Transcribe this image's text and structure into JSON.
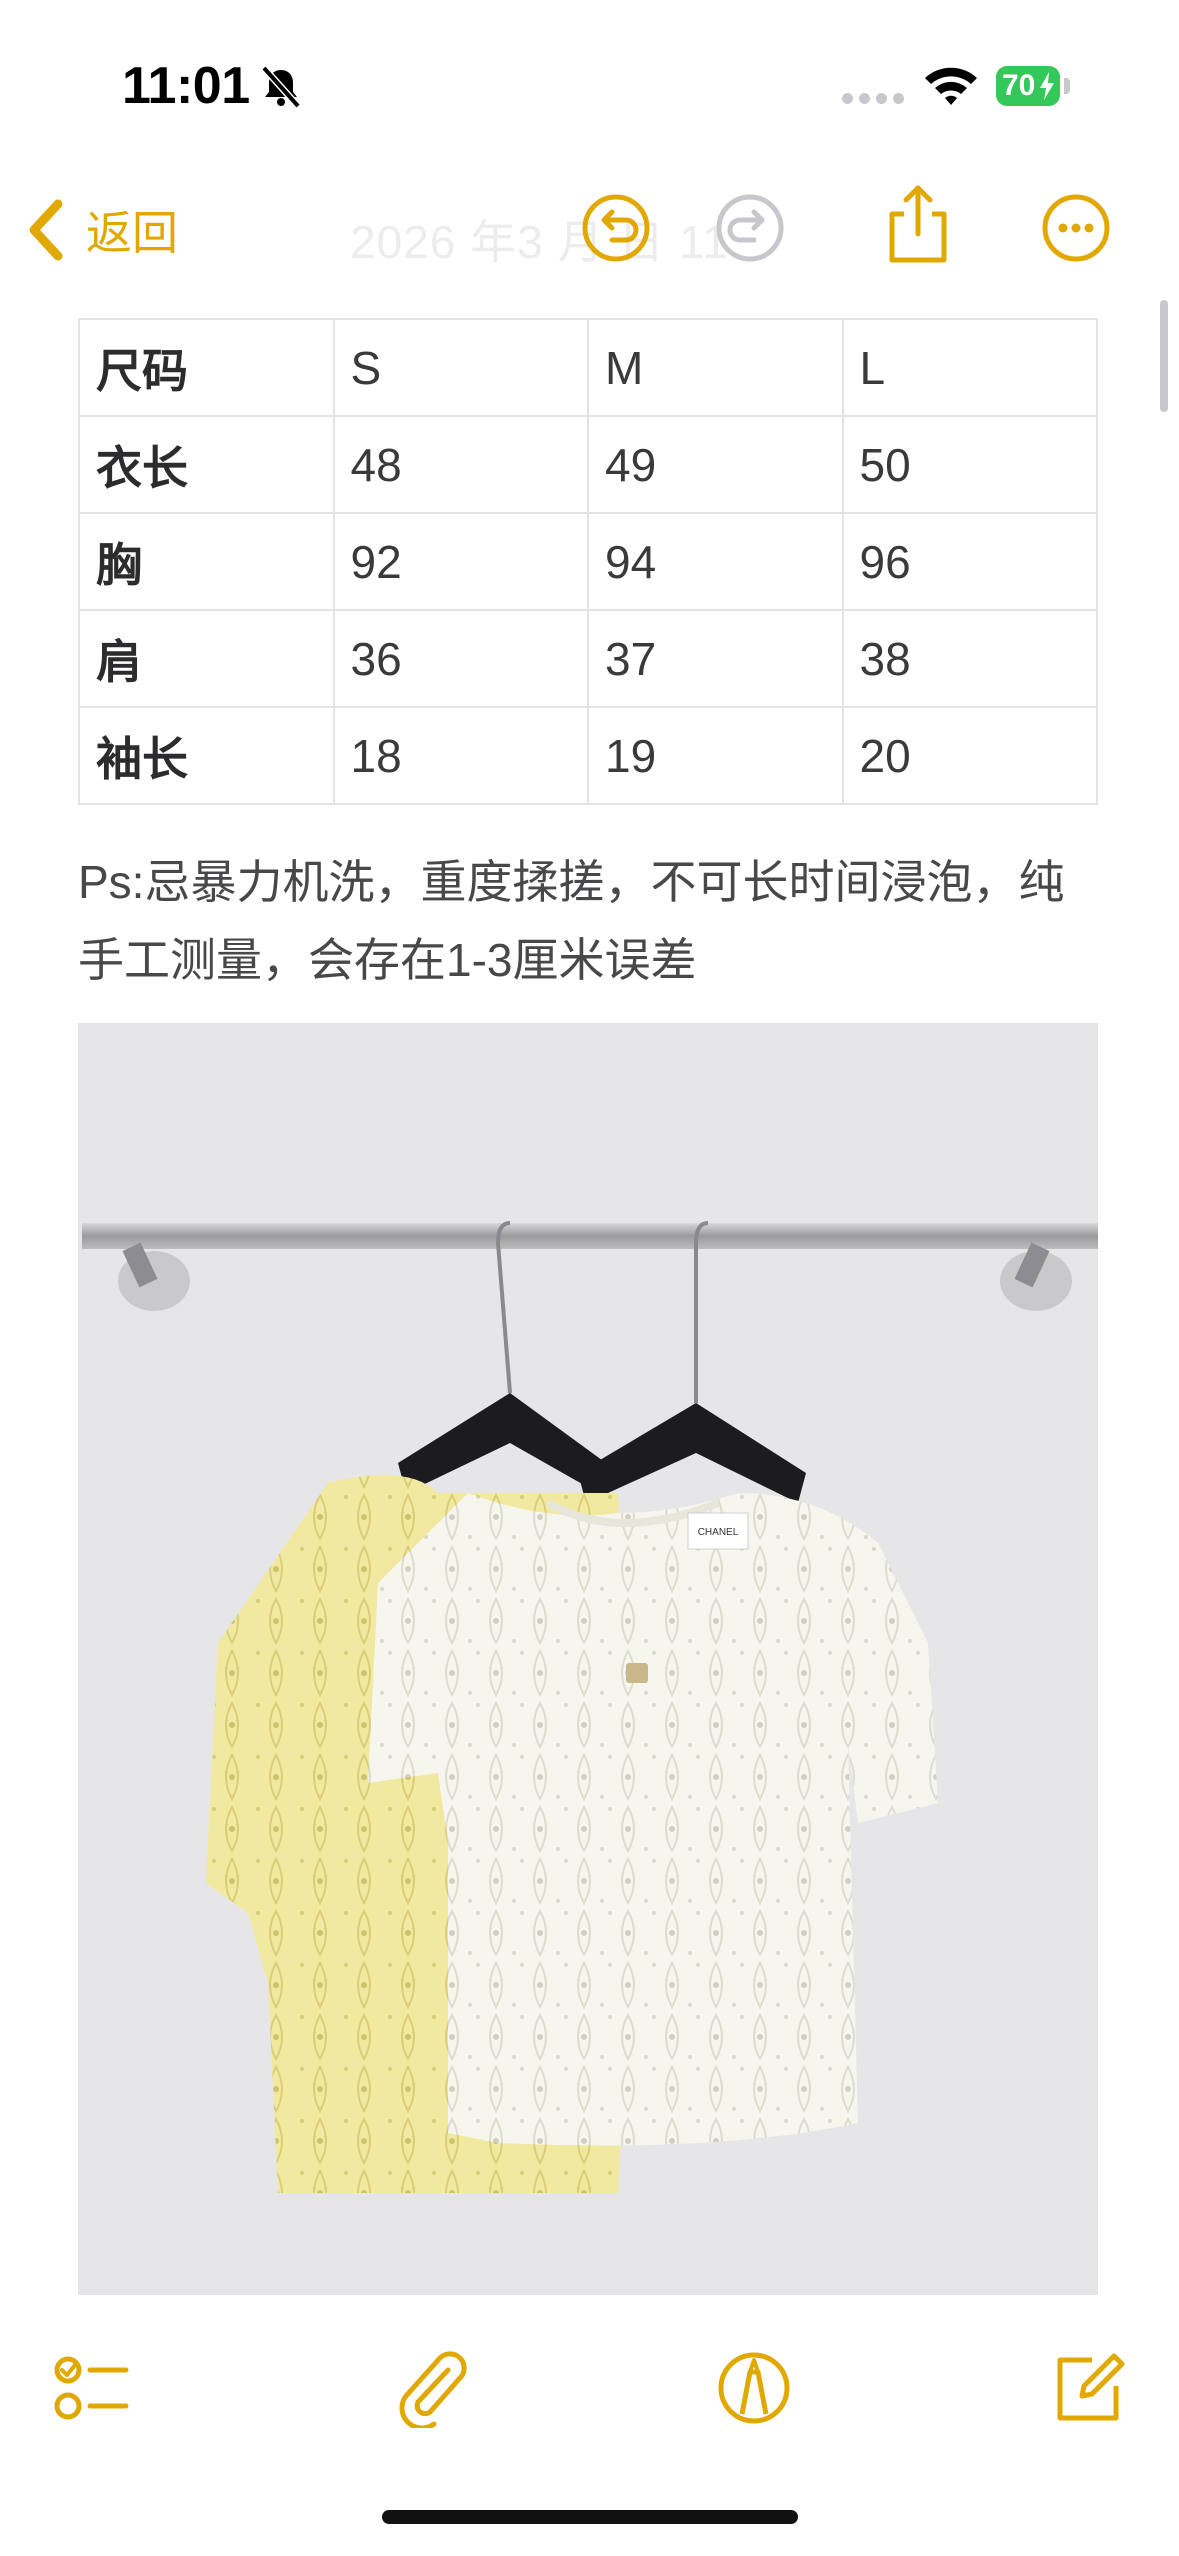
{
  "status_bar": {
    "time": "11:01",
    "battery_level": "70",
    "icons": [
      "bell-slash-icon",
      "cellular-signal-icon",
      "wifi-icon",
      "battery-charging-icon"
    ]
  },
  "nav": {
    "back_label": "返回",
    "title": "2026 年3 月 日 11",
    "icons": [
      "chevron-left-icon",
      "undo-icon",
      "redo-icon",
      "share-icon",
      "more-icon"
    ],
    "accent_color": "#e0a800",
    "disabled_color": "#c7c7cc"
  },
  "size_table": {
    "rows": [
      [
        "尺码",
        "S",
        "M",
        "L"
      ],
      [
        "衣长",
        "48",
        "49",
        "50"
      ],
      [
        "胸",
        "92",
        "94",
        "96"
      ],
      [
        "肩",
        "36",
        "37",
        "38"
      ],
      [
        "袖长",
        "18",
        "19",
        "20"
      ]
    ]
  },
  "note": "Ps:忌暴力机洗，重度揉搓，不可长时间浸泡，纯手工测量，会存在1-3厘米误差",
  "photo": {
    "description_icon": "product-photo",
    "tag_text": "CHANEL"
  },
  "toolbar": {
    "icons": [
      "checklist-icon",
      "paperclip-icon",
      "markup-pen-icon",
      "compose-icon"
    ]
  }
}
